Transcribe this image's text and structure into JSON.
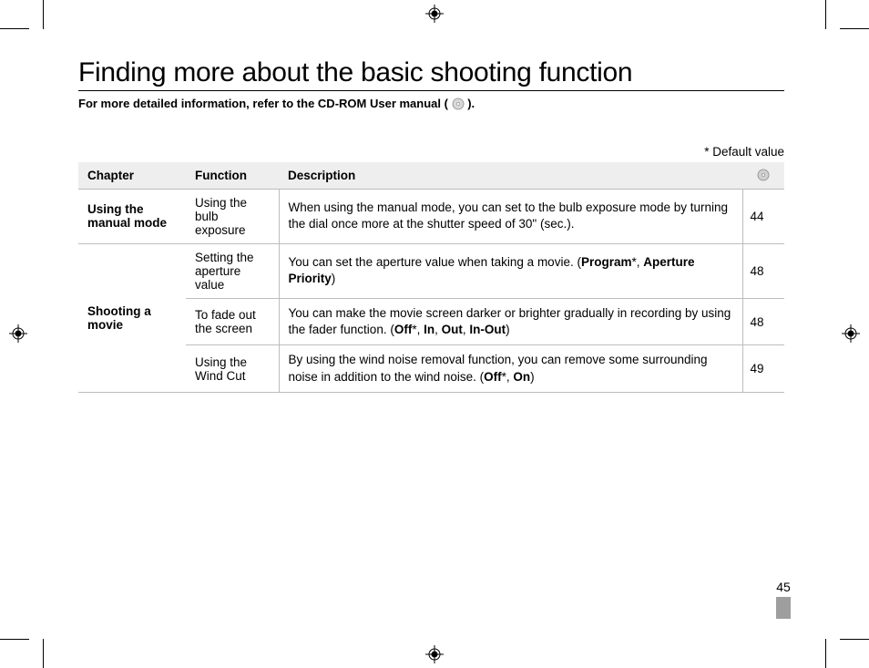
{
  "title": "Finding more about the basic shooting function",
  "subtitle_pre": "For more detailed information, refer to the CD-ROM User manual (",
  "subtitle_post": ").",
  "default_note": "* Default value",
  "headers": {
    "chapter": "Chapter",
    "function": "Function",
    "description": "Description"
  },
  "rows": [
    {
      "chapter": "Using the manual mode",
      "function": "Using the bulb exposure",
      "desc_pre": "When using the manual mode, you can set to the bulb exposure mode by turning the dial once more at the shutter speed of 30\" (sec.).",
      "page": "44"
    },
    {
      "chapter": "Shooting a movie",
      "function": "Setting the aperture value",
      "desc_pre": "You can set the aperture value when taking a movie. (",
      "opt1": "Program",
      "sep1": "*, ",
      "opt2": "Aperture Priority",
      "desc_post": ")",
      "page": "48"
    },
    {
      "function": "To fade out the screen",
      "desc_pre": "You can make the movie screen darker or brighter gradually in recording by using the fader function. (",
      "opt1": "Off",
      "sep1": "*, ",
      "opt2": "In",
      "sep2": ", ",
      "opt3": "Out",
      "sep3": ", ",
      "opt4": "In-Out",
      "desc_post": ")",
      "page": "48"
    },
    {
      "function": "Using the Wind Cut",
      "desc_pre": "By using the wind noise removal function, you can remove some surrounding noise in addition to the wind noise. (",
      "opt1": "Off",
      "sep1": "*, ",
      "opt2": "On",
      "desc_post": ")",
      "page": "49"
    }
  ],
  "page_number": "45"
}
